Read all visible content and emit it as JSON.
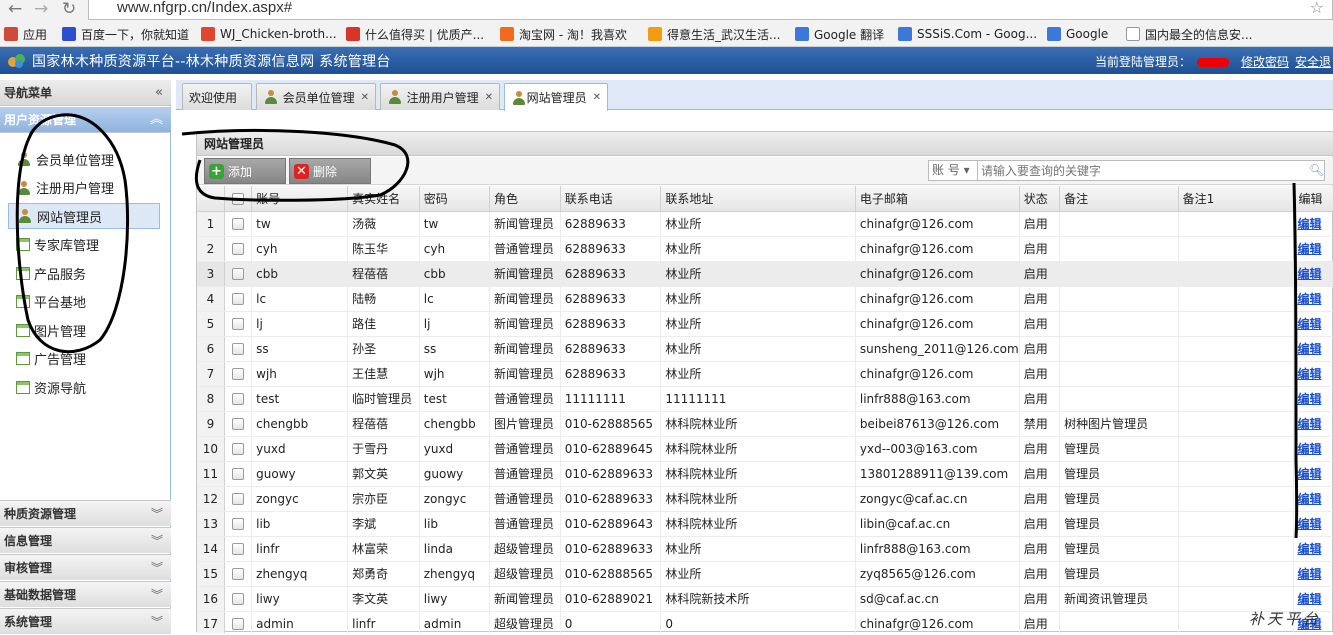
{
  "browser": {
    "url": "www.nfgrp.cn/Index.aspx#",
    "bookmarks": [
      {
        "label": "应用",
        "icon": "apps-grid-icon",
        "color": "#d04a3a"
      },
      {
        "label": "百度一下，你就知道",
        "icon": "baidu-icon",
        "color": "#2b4fd0"
      },
      {
        "label": "WJ_Chicken-broth...",
        "icon": "weibo-icon",
        "color": "#e0452e"
      },
      {
        "label": "什么值得买 | 优质产...",
        "icon": "smzdm-icon",
        "color": "#d8352a"
      },
      {
        "label": "淘宝网 - 淘！我喜欢",
        "icon": "taobao-icon",
        "color": "#f26a1b"
      },
      {
        "label": "得意生活_武汉生活...",
        "icon": "deyi-icon",
        "color": "#f39c12"
      },
      {
        "label": "Google 翻译",
        "icon": "translate-icon",
        "color": "#3c78d8"
      },
      {
        "label": "SSSiS.Com - Goog...",
        "icon": "google-icon",
        "color": "#3c78d8"
      },
      {
        "label": "Google",
        "icon": "google-icon",
        "color": "#3c78d8"
      },
      {
        "label": "国内最全的信息安...",
        "icon": "page-icon",
        "color": "#ffffff"
      }
    ]
  },
  "app": {
    "title": "国家林木种质资源平台--林木种质资源信息网 系统管理台",
    "current_admin_label": "当前登陆管理员：",
    "change_password": "修改密码",
    "logout": "安全退"
  },
  "sidebar": {
    "nav_title": "导航菜单",
    "nav_chevron": "«",
    "active_group": "用户资源管理",
    "items": [
      {
        "label": "会员单位管理",
        "icon": "user-icon",
        "selected": false
      },
      {
        "label": "注册用户管理",
        "icon": "user-icon",
        "selected": false
      },
      {
        "label": "网站管理员",
        "icon": "user-icon",
        "selected": true
      },
      {
        "label": "专家库管理",
        "icon": "tab-icon",
        "selected": false
      },
      {
        "label": "产品服务",
        "icon": "tab-icon",
        "selected": false
      },
      {
        "label": "平台基地",
        "icon": "tab-icon",
        "selected": false
      },
      {
        "label": "图片管理",
        "icon": "tab-icon",
        "selected": false
      },
      {
        "label": "广告管理",
        "icon": "tab-icon",
        "selected": false
      },
      {
        "label": "资源导航",
        "icon": "tab-icon",
        "selected": false
      }
    ],
    "groups": [
      "种质资源管理",
      "信息管理",
      "审核管理",
      "基础数据管理",
      "系统管理"
    ]
  },
  "tabs": [
    {
      "label": "欢迎使用",
      "closable": false,
      "active": false
    },
    {
      "label": "会员单位管理",
      "closable": true,
      "active": false
    },
    {
      "label": "注册用户管理",
      "closable": true,
      "active": false
    },
    {
      "label": "网站管理员",
      "closable": true,
      "active": true
    }
  ],
  "panel": {
    "title": "网站管理员",
    "add_label": "添加",
    "delete_label": "删除",
    "search_field": "账 号 ▾",
    "search_placeholder": "请输入要查询的关键字"
  },
  "grid": {
    "columns": [
      "",
      "",
      "账号",
      "真实姓名",
      "密码",
      "角色",
      "联系电话",
      "联系地址",
      "电子邮箱",
      "状态",
      "备注",
      "备注1",
      "编辑"
    ],
    "edit_label": "编辑",
    "rows": [
      [
        "1",
        "tw",
        "汤薇",
        "tw",
        "新闻管理员",
        "62889633",
        "林业所",
        "chinafgr@126.com",
        "启用",
        "",
        ""
      ],
      [
        "2",
        "cyh",
        "陈玉华",
        "cyh",
        "普通管理员",
        "62889633",
        "林业所",
        "chinafgr@126.com",
        "启用",
        "",
        ""
      ],
      [
        "3",
        "cbb",
        "程蓓蓓",
        "cbb",
        "新闻管理员",
        "62889633",
        "林业所",
        "chinafgr@126.com",
        "启用",
        "",
        ""
      ],
      [
        "4",
        "lc",
        "陆畅",
        "lc",
        "新闻管理员",
        "62889633",
        "林业所",
        "chinafgr@126.com",
        "启用",
        "",
        ""
      ],
      [
        "5",
        "lj",
        "路佳",
        "lj",
        "新闻管理员",
        "62889633",
        "林业所",
        "chinafgr@126.com",
        "启用",
        "",
        ""
      ],
      [
        "6",
        "ss",
        "孙圣",
        "ss",
        "新闻管理员",
        "62889633",
        "林业所",
        "sunsheng_2011@126.com",
        "启用",
        "",
        ""
      ],
      [
        "7",
        "wjh",
        "王佳慧",
        "wjh",
        "新闻管理员",
        "62889633",
        "林业所",
        "chinafgr@126.com",
        "启用",
        "",
        ""
      ],
      [
        "8",
        "test",
        "临时管理员",
        "test",
        "普通管理员",
        "11111111",
        "11111111",
        "linfr888@163.com",
        "启用",
        "",
        ""
      ],
      [
        "9",
        "chengbb",
        "程蓓蓓",
        "chengbb",
        "图片管理员",
        "010-62888565",
        "林科院林业所",
        "beibei87613@126.com",
        "禁用",
        "树种图片管理员",
        ""
      ],
      [
        "10",
        "yuxd",
        "于雪丹",
        "yuxd",
        "普通管理员",
        "010-62889645",
        "林科院林业所",
        "yxd--003@163.com",
        "启用",
        "管理员",
        ""
      ],
      [
        "11",
        "guowy",
        "郭文英",
        "guowy",
        "普通管理员",
        "010-62889633",
        "林科院林业所",
        "13801288911@139.com",
        "启用",
        "管理员",
        ""
      ],
      [
        "12",
        "zongyc",
        "宗亦臣",
        "zongyc",
        "普通管理员",
        "010-62889633",
        "林科院林业所",
        "zongyc@caf.ac.cn",
        "启用",
        "管理员",
        ""
      ],
      [
        "13",
        "lib",
        "李斌",
        "lib",
        "普通管理员",
        "010-62889643",
        "林科院林业所",
        "libin@caf.ac.cn",
        "启用",
        "管理员",
        ""
      ],
      [
        "14",
        "linfr",
        "林富荣",
        "linda",
        "超级管理员",
        "010-62889633",
        "林业所",
        "linfr888@163.com",
        "启用",
        "管理员",
        ""
      ],
      [
        "15",
        "zhengyq",
        "郑勇奇",
        "zhengyq",
        "超级管理员",
        "010-62888565",
        "林业所",
        "zyq8565@126.com",
        "启用",
        "管理员",
        ""
      ],
      [
        "16",
        "liwy",
        "李文英",
        "liwy",
        "新闻管理员",
        "010-62889021",
        "林科院新技术所",
        "sd@caf.ac.cn",
        "启用",
        "新闻资讯管理员",
        ""
      ],
      [
        "17",
        "admin",
        "linfr",
        "admin",
        "超级管理员",
        "0",
        "0",
        "chinafgr@126.com",
        "启用",
        "",
        ""
      ]
    ]
  },
  "watermark": "补天平台"
}
